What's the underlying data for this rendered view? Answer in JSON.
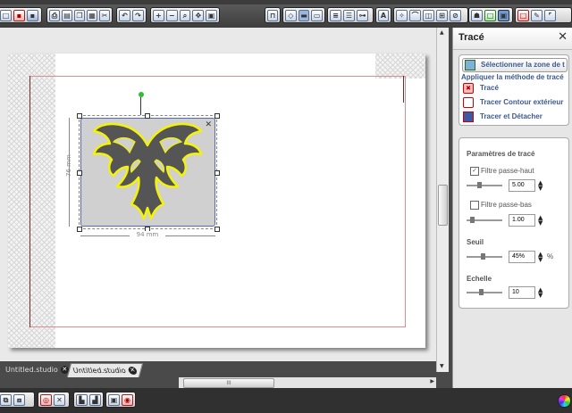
{
  "toolbar": {
    "groups": [
      {
        "icons": [
          "new-icon",
          "save-icon",
          "save-as-icon"
        ]
      },
      {
        "icons": [
          "print-icon",
          "printer-icon",
          "copy-icon",
          "paste-icon",
          "cut-icon"
        ]
      },
      {
        "icons": [
          "undo-icon",
          "redo-icon"
        ]
      },
      {
        "icons": [
          "zoom-in-icon",
          "zoom-out-icon",
          "zoom-select-icon",
          "pan-icon",
          "fit-page-icon"
        ]
      },
      {
        "icons": [
          "lock-icon"
        ]
      },
      {
        "icons": [
          "fill-icon",
          "line-color-icon",
          "line-style-icon"
        ]
      },
      {
        "icons": [
          "align-icon",
          "replicate-icon",
          "weld-icon"
        ]
      },
      {
        "icons": [
          "text-icon"
        ]
      },
      {
        "icons": [
          "point-edit-icon",
          "knife-icon",
          "eraser-icon",
          "grid-icon",
          "trace-icon"
        ]
      },
      {
        "icons": [
          "store-icon",
          "page-setup-icon",
          "cut-settings-icon"
        ]
      },
      {
        "icons": [
          "page-icon",
          "pen-icon",
          "select-icon"
        ]
      }
    ],
    "text_icon_label": "A"
  },
  "canvas": {
    "dim_width": "94 mm",
    "dim_height": "76 mm"
  },
  "tabs": [
    {
      "label": "Untitled.studio",
      "active": false
    },
    {
      "label": "Untitled.studio",
      "active": true
    }
  ],
  "hscroll_label": "III",
  "panel": {
    "title": "Tracé",
    "close_label": "✕",
    "select_area_label": "Sélectionner la zone de t",
    "apply_method_label": "Appliquer la méthode de tracé",
    "methods": [
      {
        "label": "Tracé",
        "icon": "trace-method-icon"
      },
      {
        "label": "Tracer Contour extérieur",
        "icon": "outline-trace-icon"
      },
      {
        "label": "Tracer et Détacher",
        "icon": "trace-detach-icon"
      }
    ],
    "params_title": "Paramètres de tracé",
    "highpass": {
      "label": "Filtre passe-haut",
      "checked": true,
      "value": "5.00",
      "level": 0.35
    },
    "lowpass": {
      "label": "Filtre passe-bas",
      "checked": false,
      "value": "1.00",
      "level": 0.1
    },
    "threshold": {
      "label": "Seuil",
      "value": "45%",
      "unit": "%",
      "level": 0.45
    },
    "scale": {
      "label": "Echelle",
      "value": "10",
      "level": 0.4
    }
  },
  "bottom_icons": [
    "group-icon",
    "ungroup-icon",
    "bring-front-icon",
    "send-back-icon",
    "bring-forward-icon",
    "send-backward-icon",
    "shadow-icon",
    "target-icon"
  ],
  "colors": {
    "accent": "#6f9ad0",
    "trace_yellow": "#f2f20a",
    "cut_line": "#d97a7a"
  }
}
